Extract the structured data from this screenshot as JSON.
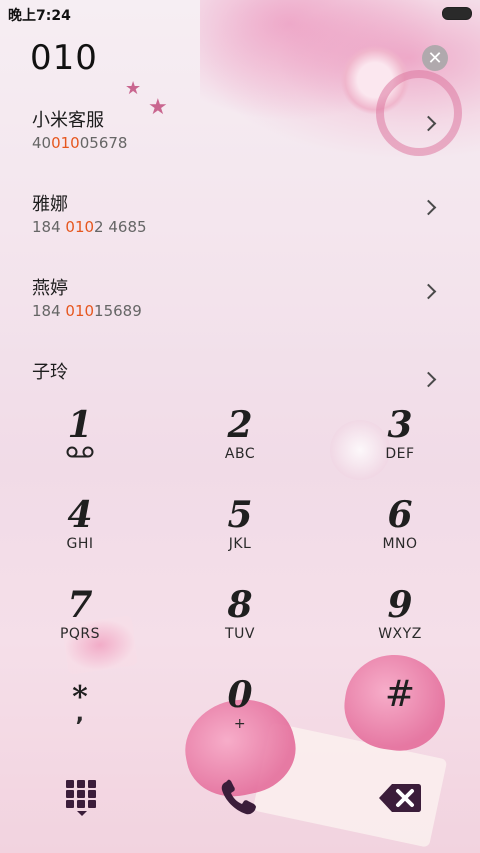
{
  "status_bar": {
    "time": "晚上7:24"
  },
  "dialer": {
    "input": "010"
  },
  "contacts": [
    {
      "name": "小米客服",
      "number_pre": "40",
      "number_match": "010",
      "number_post": "05678"
    },
    {
      "name": "雅娜",
      "number_pre": "184 ",
      "number_match": "010",
      "number_post": "2 4685"
    },
    {
      "name": "燕婷",
      "number_pre": "184 ",
      "number_match": "010",
      "number_post": "15689"
    },
    {
      "name": "子玲",
      "number_pre": "",
      "number_match": "",
      "number_post": ""
    }
  ],
  "keypad": [
    {
      "digit": "1",
      "letters": "",
      "icon": "voicemail-icon"
    },
    {
      "digit": "2",
      "letters": "ABC"
    },
    {
      "digit": "3",
      "letters": "DEF"
    },
    {
      "digit": "4",
      "letters": "GHI"
    },
    {
      "digit": "5",
      "letters": "JKL"
    },
    {
      "digit": "6",
      "letters": "MNO"
    },
    {
      "digit": "7",
      "letters": "PQRS"
    },
    {
      "digit": "8",
      "letters": "TUV"
    },
    {
      "digit": "9",
      "letters": "WXYZ"
    },
    {
      "digit": "*",
      "letters": ","
    },
    {
      "digit": "0",
      "letters": "+"
    },
    {
      "digit": "#",
      "letters": ""
    }
  ],
  "colors": {
    "match_highlight": "#e6571f",
    "icon_dark": "#3b1d3a"
  },
  "icons": {
    "clear": "clear-circle-icon",
    "chevron": "chevron-right-icon",
    "keypad_toggle": "dialpad-icon",
    "call": "phone-icon",
    "backspace": "backspace-icon"
  }
}
